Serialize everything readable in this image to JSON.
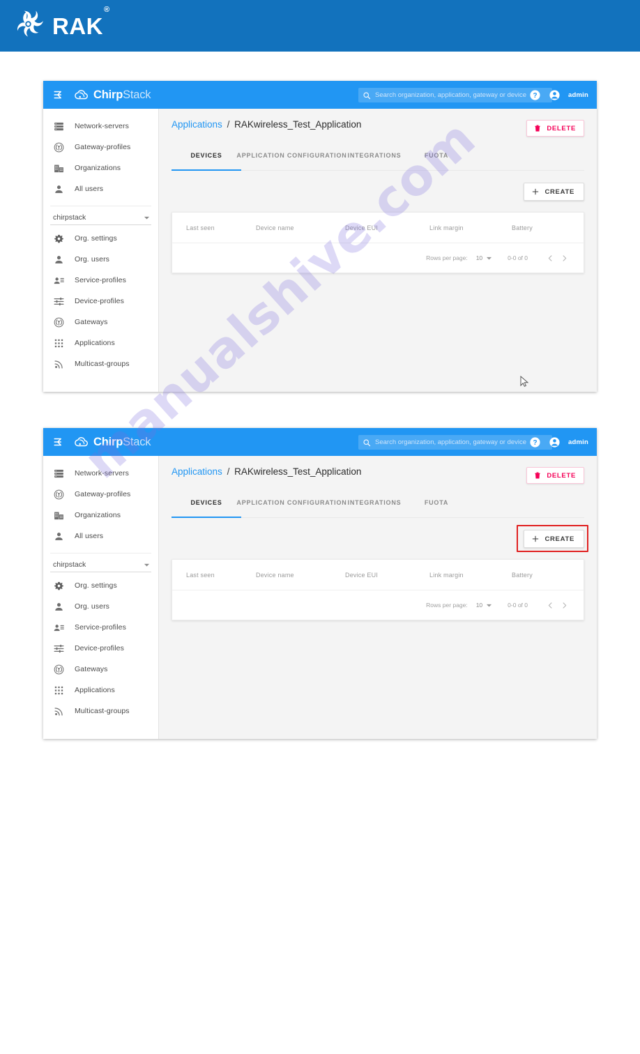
{
  "brand_bar": {
    "logo_icon": "rak-swirl-logo-icon",
    "wordmark": "RAK",
    "registered_mark": "®",
    "background_color": "#1272bd"
  },
  "watermark": {
    "text": "manualshive.com",
    "color": "#7c6edb"
  },
  "app": {
    "menu_icon": "collapse-menu-arrow-icon",
    "logo_icon": "chirpstack-cloud-icon",
    "brand_primary": "Chirp",
    "brand_secondary": "Stack",
    "accent_color": "#2196f3",
    "search": {
      "icon": "search-icon",
      "value": "",
      "placeholder": "Search organization, application, gateway or device"
    },
    "help_icon": "help-circle-icon",
    "account_icon": "account-circle-icon",
    "user_label": "admin"
  },
  "sidebar": {
    "global_items": [
      {
        "label": "Network-servers",
        "icon": "storage-icon"
      },
      {
        "label": "Gateway-profiles",
        "icon": "router-antenna-icon"
      },
      {
        "label": "Organizations",
        "icon": "business-building-icon"
      },
      {
        "label": "All users",
        "icon": "person-icon"
      }
    ],
    "org_selector": {
      "value": "chirpstack",
      "icon": "chevron-down-icon"
    },
    "org_items": [
      {
        "label": "Org. settings",
        "icon": "gear-icon"
      },
      {
        "label": "Org. users",
        "icon": "person-icon"
      },
      {
        "label": "Service-profiles",
        "icon": "person-list-icon"
      },
      {
        "label": "Device-profiles",
        "icon": "tune-sliders-icon"
      },
      {
        "label": "Gateways",
        "icon": "router-antenna-icon"
      },
      {
        "label": "Applications",
        "icon": "apps-grid-icon"
      },
      {
        "label": "Multicast-groups",
        "icon": "rss-broadcast-icon"
      }
    ]
  },
  "page": {
    "breadcrumb": {
      "parent": "Applications",
      "separator": "/",
      "current": "RAKwireless_Test_Application"
    },
    "delete_button": {
      "label": "DELETE",
      "icon": "trash-icon",
      "color": "#f50057"
    },
    "tabs": [
      {
        "label": "DEVICES",
        "active": true
      },
      {
        "label": "APPLICATION CONFIGURATION",
        "active": false
      },
      {
        "label": "INTEGRATIONS",
        "active": false
      },
      {
        "label": "FUOTA",
        "active": false
      }
    ],
    "create_button": {
      "label": "CREATE",
      "icon": "plus-icon"
    },
    "table": {
      "columns": [
        "Last seen",
        "Device name",
        "Device EUI",
        "Link margin",
        "Battery"
      ],
      "rows": [],
      "pagination": {
        "rows_per_page_label": "Rows per page:",
        "rows_per_page_value": "10",
        "rows_per_page_icon": "chevron-down-icon",
        "range": "0-0 of 0",
        "prev_icon": "chevron-left-icon",
        "next_icon": "chevron-right-icon"
      }
    }
  },
  "annotation": {
    "highlight_color": "#e02020",
    "target": "create-button"
  }
}
